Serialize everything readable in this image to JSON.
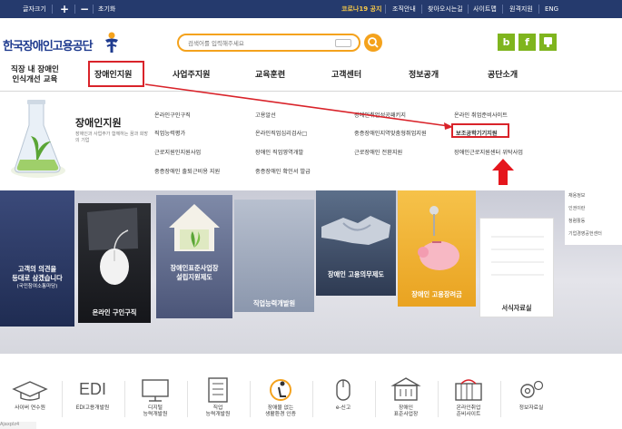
{
  "topbar": {
    "font_size_label": "글자크기",
    "plus": "+",
    "minus": "−",
    "reset": "초기화",
    "corona_notice": "코로나19 공지",
    "org_guide": "조직안내",
    "directions": "찾아오시는길",
    "sitemap": "사이트맵",
    "remote": "원격지원",
    "eng": "ENG"
  },
  "header": {
    "logo_text": "한국장애인고용공단",
    "search_placeholder": "검색어를 입력해주세요",
    "sns": [
      "b",
      "f",
      "blog"
    ]
  },
  "gnb": [
    {
      "label_line1": "직장 내 장애인",
      "label_line2": "인식개선 교육"
    },
    {
      "label": "장애인지원"
    },
    {
      "label": "사업주지원"
    },
    {
      "label": "교육훈련"
    },
    {
      "label": "고객센터"
    },
    {
      "label": "정보공개"
    },
    {
      "label": "공단소개"
    }
  ],
  "dropdown": {
    "title": "장애인지원",
    "subtitle": "장애인과 사업주가 함께하는 꿈과 희망의 기업",
    "links": [
      "온라인구인구직",
      "고용알선",
      "장애인취업성공패키지",
      "온라인 취업준비사이트",
      "직업능력평가",
      "온라인직업심리검사□",
      "중증장애인지역맞춤형취업지원",
      "보조공학기기지원",
      "근로지원인지원사업",
      "장애인 직업영역개발",
      "근로장애인 전환지원",
      "장애인근로지원센터 위탁사업",
      "중증장애인 출퇴근비용 지원",
      "중증장애인 확인서 발급"
    ]
  },
  "banner": {
    "card1_line1": "고객의 의견을",
    "card1_line2": "등대로 삼겠습니다",
    "card1_line3": "(국민참여소통마당)",
    "card2": "온라인 구인구직",
    "card3_line1": "장애인표준사업장",
    "card3_line2": "설립지원제도",
    "card4": "직업능력개발원",
    "card5": "장애인 고용의무제도",
    "card6": "장애인 고용장려금",
    "card7": "서식자료실",
    "side_items": [
      "채용정보",
      "인권이란",
      "청렴활동",
      "기업경영공헌센터"
    ]
  },
  "quick_menu": [
    {
      "icon": "graduation-cap-icon",
      "line1": "사이버 연수원",
      "line2": ""
    },
    {
      "icon": "edi-icon",
      "line1": "EDI고용개발원",
      "line2": ""
    },
    {
      "icon": "monitor-icon",
      "line1": "디지털",
      "line2": "능력개발원"
    },
    {
      "icon": "building-icon",
      "line1": "직업",
      "line2": "능력개발원"
    },
    {
      "icon": "certificate-icon",
      "line1": "장애물 없는",
      "line2": "생활환경 인증"
    },
    {
      "icon": "mouse-icon",
      "line1": "e-신고",
      "line2": ""
    },
    {
      "icon": "workplace-icon",
      "line1": "장애인",
      "line2": "표준사업장"
    },
    {
      "icon": "books-icon",
      "line1": "온라인취업",
      "line2": "준비사이트"
    },
    {
      "icon": "gears-icon",
      "line1": "정보자료실",
      "line2": ""
    }
  ],
  "status_text": "Ajaxplz4",
  "colors": {
    "topbar": "#253a6d",
    "accent_orange": "#f4a21c",
    "highlight_red": "#d9232a",
    "logo_blue": "#1f3b8f"
  }
}
